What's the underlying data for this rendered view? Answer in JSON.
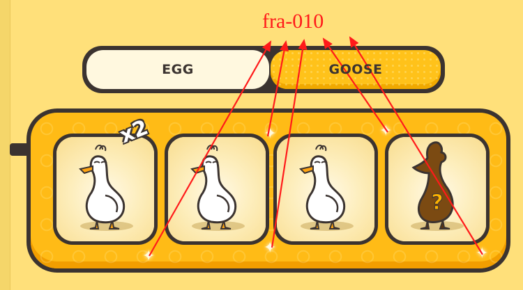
{
  "annotation": {
    "label": "fra-010",
    "color": "#ff1a1a"
  },
  "tabs": [
    {
      "label": "EGG",
      "selected": false
    },
    {
      "label": "GOOSE",
      "selected": true
    }
  ],
  "cards": [
    {
      "character": "white-goose",
      "state": "unlocked",
      "badge": "x2"
    },
    {
      "character": "white-goose",
      "state": "unlocked"
    },
    {
      "character": "white-goose",
      "state": "unlocked"
    },
    {
      "character": "mystery-goose",
      "state": "locked",
      "hint": "?"
    }
  ],
  "colors": {
    "background": "#ffe07a",
    "panel": "#ffbb16",
    "outline": "#3b3330",
    "tab_active": "#ffc21a",
    "tab_inactive": "#fff8df",
    "locked_silhouette": "#7b4a12",
    "question_mark": "#ffb300"
  }
}
